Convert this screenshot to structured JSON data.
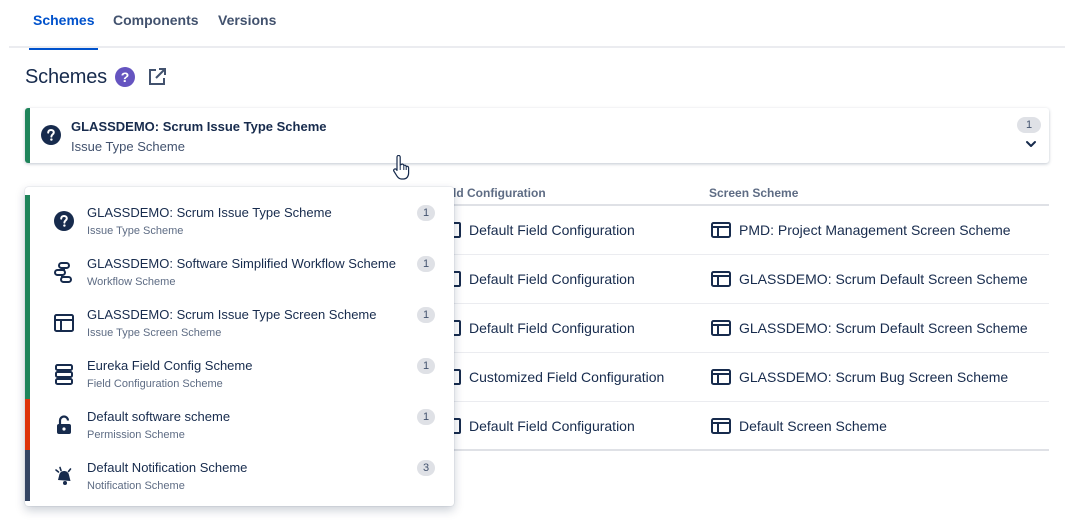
{
  "tabs": [
    {
      "label": "Schemes",
      "active": true
    },
    {
      "label": "Components",
      "active": false
    },
    {
      "label": "Versions",
      "active": false
    }
  ],
  "heading": {
    "title": "Schemes",
    "help_glyph": "?",
    "icons": [
      "help-icon",
      "external-link-icon"
    ]
  },
  "selector": {
    "title": "GLASSDEMO: Scrum Issue Type Scheme",
    "subtitle": "Issue Type Scheme",
    "count": "1",
    "icon": "question-icon",
    "accent": "#1f845a"
  },
  "table": {
    "headers": {
      "field_configuration": "ld Configuration",
      "screen_scheme": "Screen Scheme"
    },
    "rows": [
      {
        "field_configuration": "Default Field Configuration",
        "screen_scheme": "PMD: Project Management Screen Scheme"
      },
      {
        "field_configuration": "Default Field Configuration",
        "screen_scheme": "GLASSDEMO: Scrum Default Screen Scheme"
      },
      {
        "field_configuration": "Default Field Configuration",
        "screen_scheme": "GLASSDEMO: Scrum Default Screen Scheme"
      },
      {
        "field_configuration": "Customized Field Configuration",
        "screen_scheme": "GLASSDEMO: Scrum Bug Screen Scheme"
      },
      {
        "field_configuration": "Default Field Configuration",
        "screen_scheme": "Default Screen Scheme"
      }
    ]
  },
  "dropdown": {
    "items": [
      {
        "title": "GLASSDEMO: Scrum Issue Type Scheme",
        "subtitle": "Issue Type Scheme",
        "count": "1",
        "icon": "question-icon",
        "accent": "#1f845a"
      },
      {
        "title": "GLASSDEMO: Software Simplified Workflow Scheme",
        "subtitle": "Workflow Scheme",
        "count": "1",
        "icon": "workflow-icon",
        "accent": "#1f845a"
      },
      {
        "title": "GLASSDEMO: Scrum Issue Type Screen Scheme",
        "subtitle": "Issue Type Screen Scheme",
        "count": "1",
        "icon": "screen-scheme-icon",
        "accent": "#1f845a"
      },
      {
        "title": "Eureka Field Config Scheme",
        "subtitle": "Field Configuration Scheme",
        "count": "1",
        "icon": "field-config-icon",
        "accent": "#1f845a"
      },
      {
        "title": "Default software scheme",
        "subtitle": "Permission Scheme",
        "count": "1",
        "icon": "unlock-icon",
        "accent": "#de350b"
      },
      {
        "title": "Default Notification Scheme",
        "subtitle": "Notification Scheme",
        "count": "3",
        "icon": "notification-icon",
        "accent": "#344563"
      }
    ]
  },
  "colors": {
    "primary": "#0052cc",
    "help": "#6554c0",
    "green": "#1f845a",
    "red": "#de350b",
    "dark": "#344563"
  }
}
